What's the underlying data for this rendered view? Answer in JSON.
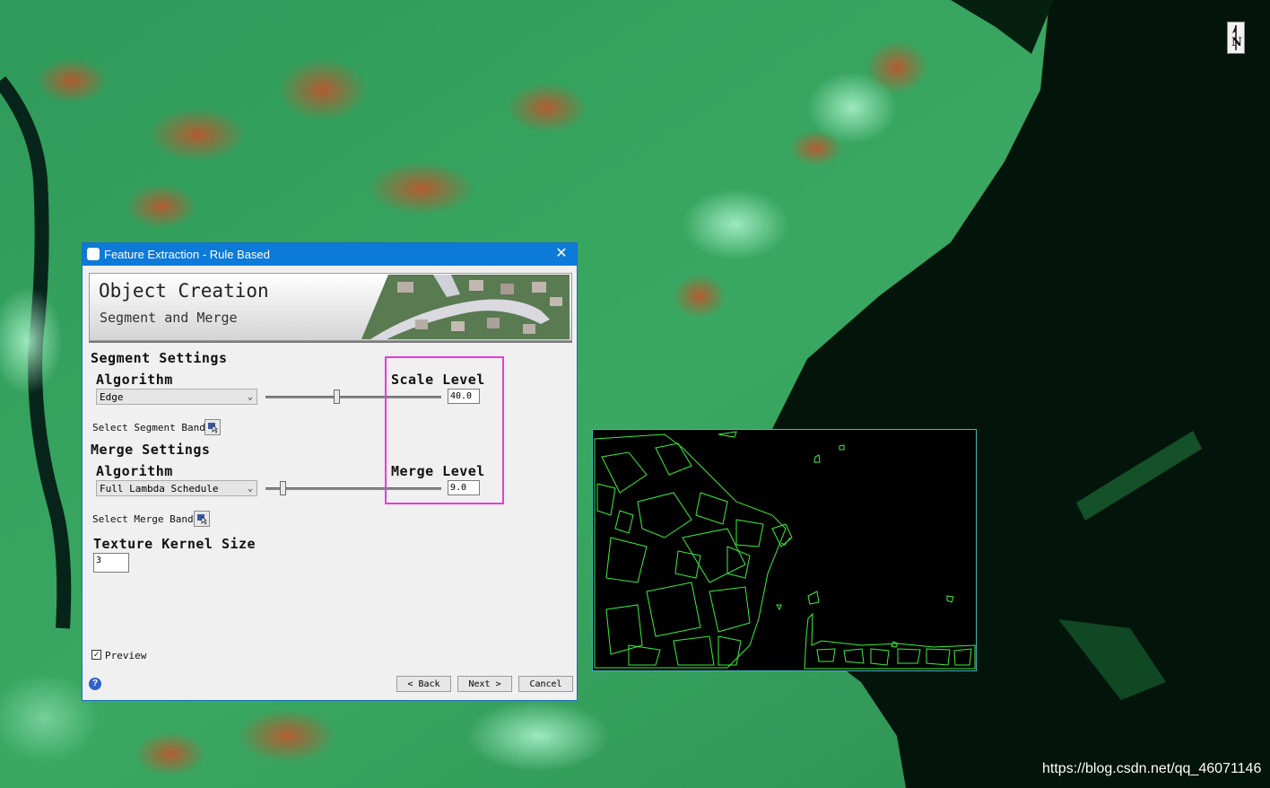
{
  "dialog": {
    "title": "Feature Extraction - Rule Based",
    "close_glyph": "✕",
    "banner": {
      "title": "Object Creation",
      "subtitle": "Segment and Merge"
    },
    "segment": {
      "heading": "Segment Settings",
      "algorithm_label": "Algorithm",
      "algorithm_value": "Edge",
      "scale_label": "Scale Level",
      "scale_value": "40.0",
      "bands_label": "Select Segment Bands"
    },
    "merge": {
      "heading": "Merge Settings",
      "algorithm_label": "Algorithm",
      "algorithm_value": "Full Lambda Schedule",
      "level_label": "Merge Level",
      "level_value": "9.0",
      "bands_label": "Select Merge Bands"
    },
    "texture": {
      "heading": "Texture Kernel Size",
      "value": "3"
    },
    "preview_label": "Preview",
    "preview_checked": true,
    "buttons": {
      "back": "< Back",
      "next": "Next >",
      "cancel": "Cancel"
    },
    "help_glyph": "?"
  },
  "map": {
    "north_label": "N"
  },
  "watermark": "https://blog.csdn.net/qq_46071146",
  "colors": {
    "titlebar": "#0c7ad8",
    "highlight": "#e83ae0",
    "segment_lines": "#3cf03c"
  },
  "icons": {
    "band_select": "band-select-icon",
    "help": "help-icon",
    "app": "app-icon"
  }
}
